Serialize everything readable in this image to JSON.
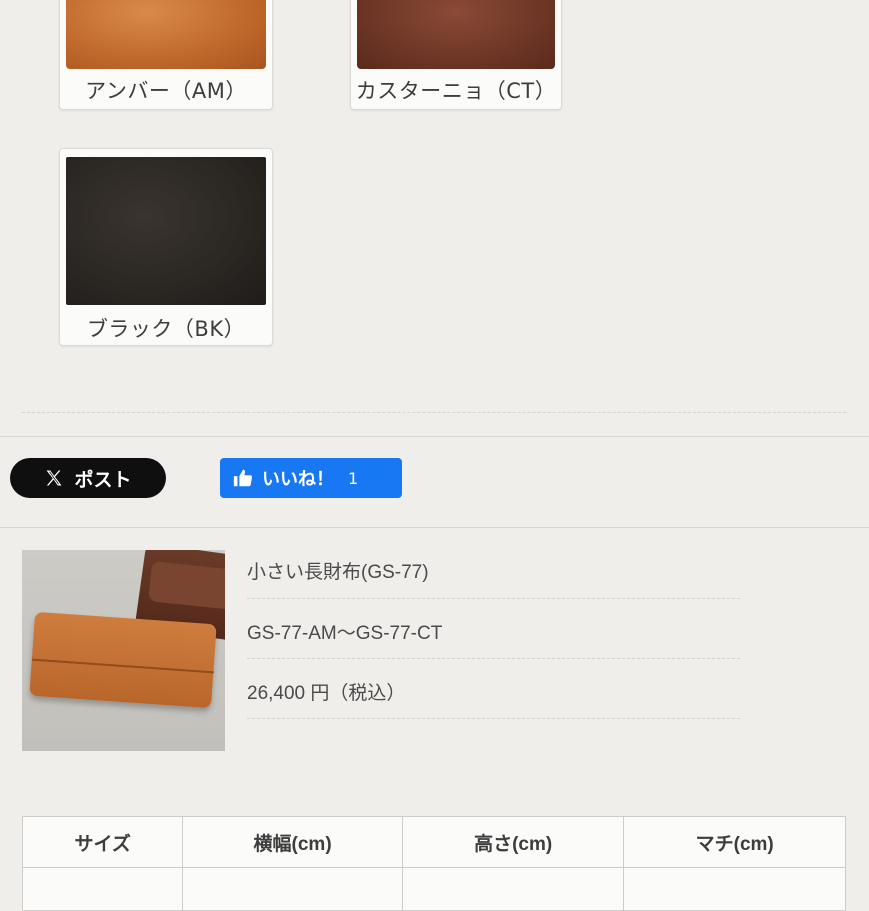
{
  "swatches": [
    {
      "label": "アンバー（AM）"
    },
    {
      "label": "カスターニョ（CT）"
    },
    {
      "label": "ブラック（BK）"
    }
  ],
  "social": {
    "x_post_label": "ポスト",
    "like_label": "いいね！",
    "like_count": "1"
  },
  "product": {
    "name": "小さい長財布(GS-77)",
    "code": "GS-77-AM〜GS-77-CT",
    "price": "26,400 円（税込）"
  },
  "spec_table": {
    "headers": [
      "サイズ",
      "横幅(cm)",
      "高さ(cm)",
      "マチ(cm)"
    ]
  },
  "colors": {
    "x_button": "#0f0f0f",
    "facebook_blue": "#1877f2",
    "background": "#efeeea"
  }
}
